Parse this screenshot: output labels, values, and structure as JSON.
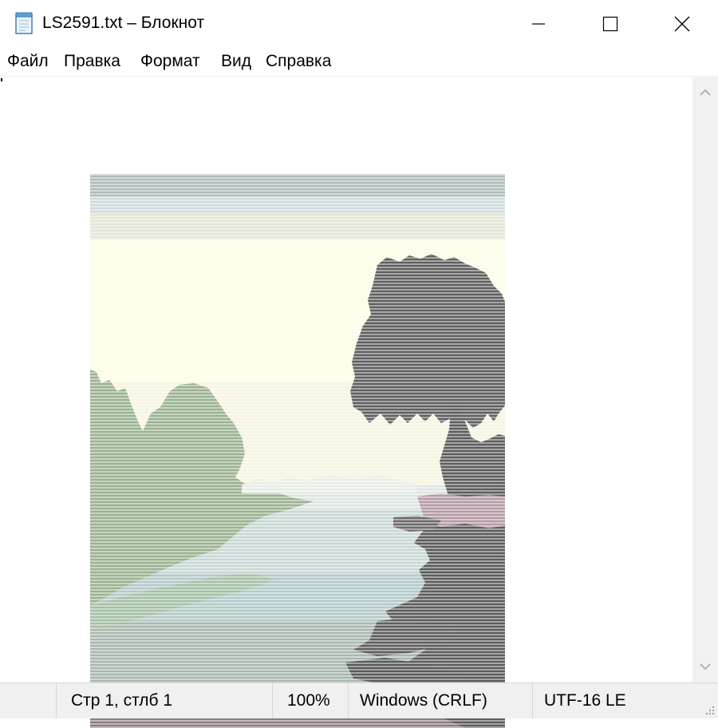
{
  "window": {
    "title": "LS2591.txt – Блокнот"
  },
  "icons": {
    "app": "notepad-icon",
    "minimize": "minimize-icon",
    "maximize": "maximize-icon",
    "close": "close-icon"
  },
  "menu": {
    "items": [
      {
        "label": "Файл"
      },
      {
        "label": "Правка"
      },
      {
        "label": "Формат"
      },
      {
        "label": "Вид"
      },
      {
        "label": "Справка"
      }
    ]
  },
  "status": {
    "position": "Стр 1, стлб 1",
    "zoom": "100%",
    "line_ending": "Windows (CRLF)",
    "encoding": "UTF-16 LE"
  },
  "colors": {
    "sky": "#fdfde9",
    "tree": "#616161",
    "foliage_green": "#9db493",
    "water": "#b9cccc",
    "pink": "#bca4ac"
  }
}
